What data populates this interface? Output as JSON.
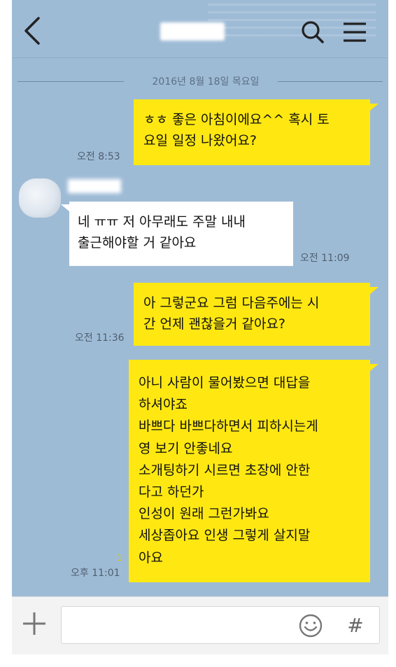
{
  "header": {
    "title": "",
    "icons": [
      "back-icon",
      "search-icon",
      "menu-icon"
    ]
  },
  "date_divider": "2016년 8월 18일 목요일",
  "messages": [
    {
      "sender": "me",
      "lines": [
        "ㅎㅎ 좋은 아침이에요^^ 혹시 토",
        "요일 일정 나왔어요?"
      ],
      "time": "오전 8:53"
    },
    {
      "sender": "other",
      "name": "",
      "lines": [
        "네 ㅠㅠ 저 아무래도 주말 내내",
        "출근해야할 거 같아요"
      ],
      "time": "오전 11:09"
    },
    {
      "sender": "me",
      "lines": [
        "아 그렇군요 그럼 다음주에는 시",
        "간 언제 괜찮을거 같아요?"
      ],
      "time": "오전 11:36"
    },
    {
      "sender": "me",
      "lines": [
        "아니 사람이 물어봤으면 대답을",
        "하셔야죠",
        "바쁘다 바쁘다하면서 피하시는게",
        "영 보기 안좋네요",
        "소개팅하기 시르면 초장에 안한",
        "다고 하던가",
        "인성이 원래 그런가봐요",
        "세상좁아요 인생 그렇게 살지말",
        "아요"
      ],
      "time": "오후 11:01",
      "unread": "1"
    }
  ],
  "input_bar": {
    "placeholder": "",
    "hash_label": "#",
    "icons": [
      "plus-icon",
      "emoji-icon",
      "hash-icon"
    ]
  },
  "colors": {
    "background": "#9ebbd6",
    "my_bubble": "#ffe812",
    "other_bubble": "#ffffff"
  }
}
